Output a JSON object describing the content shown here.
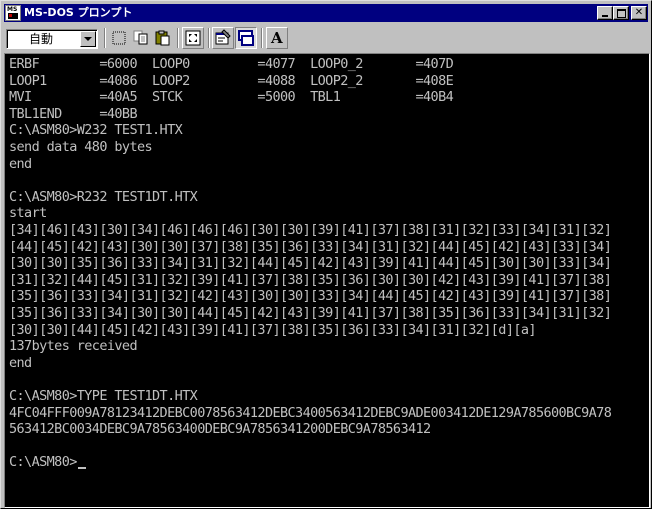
{
  "window": {
    "title": "MS-DOS プロンプト",
    "icon": "ms-dos-icon",
    "icon_text": "MS"
  },
  "title_buttons": {
    "minimize": "minimize-icon",
    "maximize": "maximize-icon",
    "close_label": "✕"
  },
  "toolbar": {
    "font_size_value": "自動",
    "tools": [
      "mark-icon",
      "copy-icon",
      "paste-icon",
      "fullscreen-icon",
      "properties-icon",
      "background-icon",
      "font-icon"
    ],
    "font_button_label": "A"
  },
  "colors": {
    "titlebar": "#000080",
    "console_background": "#000000",
    "console_text": "#c0c0c0",
    "chrome": "#c0c0c0"
  },
  "console": {
    "lines": [
      "ERBF        =6000  LOOP0         =4077  LOOP0_2       =407D",
      "LOOP1       =4086  LOOP2         =4088  LOOP2_2       =408E",
      "MVI         =40A5  STCK          =5000  TBL1          =40B4",
      "TBL1END     =40BB",
      "C:\\ASM80>W232 TEST1.HTX",
      "send data 480 bytes",
      "end",
      "",
      "C:\\ASM80>R232 TEST1DT.HTX",
      "start",
      "[34][46][43][30][34][46][46][46][30][30][39][41][37][38][31][32][33][34][31][32]",
      "[44][45][42][43][30][30][37][38][35][36][33][34][31][32][44][45][42][43][33][34]",
      "[30][30][35][36][33][34][31][32][44][45][42][43][39][41][44][45][30][30][33][34]",
      "[31][32][44][45][31][32][39][41][37][38][35][36][30][30][42][43][39][41][37][38]",
      "[35][36][33][34][31][32][42][43][30][30][33][34][44][45][42][43][39][41][37][38]",
      "[35][36][33][34][30][30][44][45][42][43][39][41][37][38][35][36][33][34][31][32]",
      "[30][30][44][45][42][43][39][41][37][38][35][36][33][34][31][32][d][a]",
      "137bytes received",
      "end",
      "",
      "C:\\ASM80>TYPE TEST1DT.HTX",
      "4FC04FFF009A78123412DEBC0078563412DEBC3400563412DEBC9ADE003412DE129A785600BC9A78",
      "563412BC0034DEBC9A78563400DEBC9A7856341200DEBC9A78563412",
      "",
      "C:\\ASM80>"
    ]
  }
}
